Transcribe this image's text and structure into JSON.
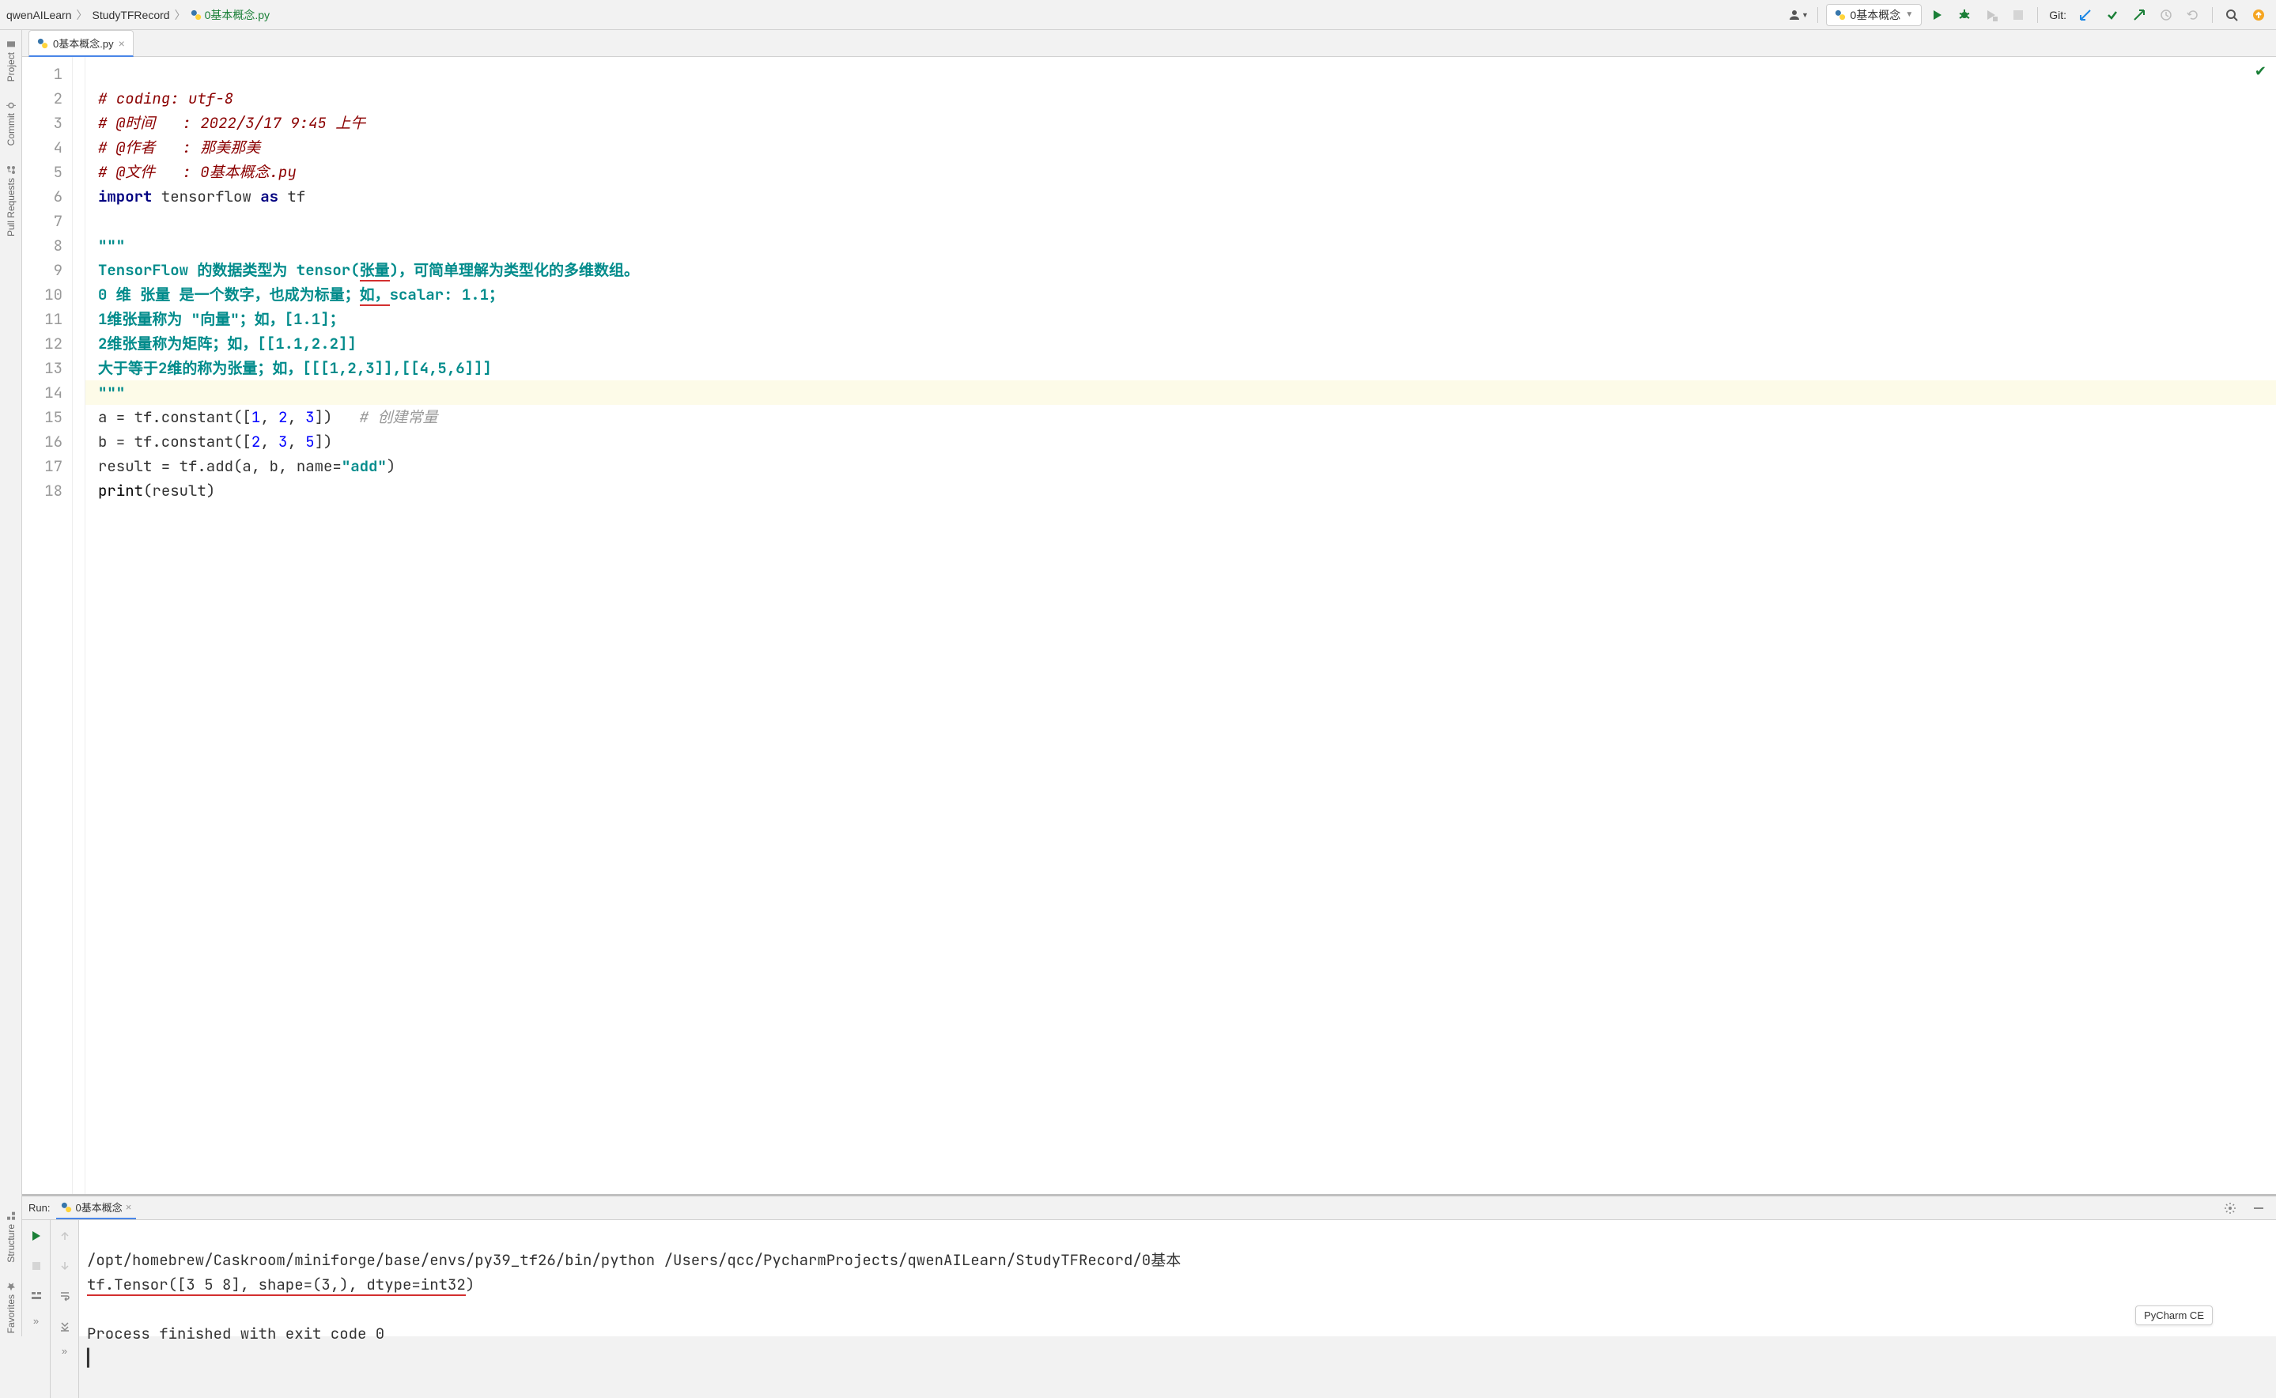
{
  "breadcrumb": {
    "root": "qwenAILearn",
    "mid": "StudyTFRecord",
    "file": "0基本概念.py"
  },
  "run_config": {
    "label": "0基本概念"
  },
  "git": {
    "label": "Git:"
  },
  "tabs": [
    {
      "label": "0基本概念.py"
    }
  ],
  "left_gutter": {
    "project": "Project",
    "commit": "Commit",
    "pull_requests": "Pull Requests",
    "structure": "Structure",
    "favorites": "Favorites"
  },
  "editor": {
    "lines": [
      "1",
      "2",
      "3",
      "4",
      "5",
      "6",
      "7",
      "8",
      "9",
      "10",
      "11",
      "12",
      "13",
      "14",
      "15",
      "16",
      "17",
      "18"
    ],
    "l1": "# coding: utf-8",
    "l2": "# @时间   : 2022/3/17 9:45 上午",
    "l3": "# @作者   : 那美那美",
    "l4": "# @文件   : 0基本概念.py",
    "l5a": "import",
    "l5b": " tensorflow ",
    "l5c": "as",
    "l5d": " tf",
    "l7": "\"\"\"",
    "l8a": "TensorFlow 的数据类型为 tensor(",
    "l8u": "张量",
    "l8b": ")，可简单理解为类型化的多维数组。",
    "l9a": "0 维 张量 是一个数字，也成为标量；",
    "l9u": "如，",
    "l9b": "scalar: 1.1；",
    "l10": "1维张量称为 \"向量\"；如，[1.1]；",
    "l11": "2维张量称为矩阵；如，[[1.1,2.2]]",
    "l12": "大于等于2维的称为张量；如，[[[1,2,3]],[[4,5,6]]]",
    "l13": "\"\"\"",
    "l14a": "a = tf.constant([",
    "l14n1": "1",
    "l14s1": ", ",
    "l14n2": "2",
    "l14s2": ", ",
    "l14n3": "3",
    "l14b": "])   ",
    "l14c": "# 创建常量",
    "l15a": "b = tf.constant([",
    "l15n1": "2",
    "l15s1": ", ",
    "l15n2": "3",
    "l15s2": ", ",
    "l15n3": "5",
    "l15b": "])",
    "l16a": "result = tf.add(a, b, ",
    "l16p": "name",
    "l16e": "=",
    "l16s": "\"add\"",
    "l16b": ")",
    "l17a": "print",
    "l17b": "(result)"
  },
  "run": {
    "title": "Run:",
    "tab": "0基本概念",
    "out1": "/opt/homebrew/Caskroom/miniforge/base/envs/py39_tf26/bin/python /Users/qcc/PycharmProjects/qwenAILearn/StudyTFRecord/0基本",
    "out2a": "tf.Tensor([3 5 8], shape=(3,), dtype=int32",
    "out2b": ")",
    "out3": "",
    "out4": "Process finished with exit code 0"
  },
  "status": {
    "product": "PyCharm CE"
  }
}
